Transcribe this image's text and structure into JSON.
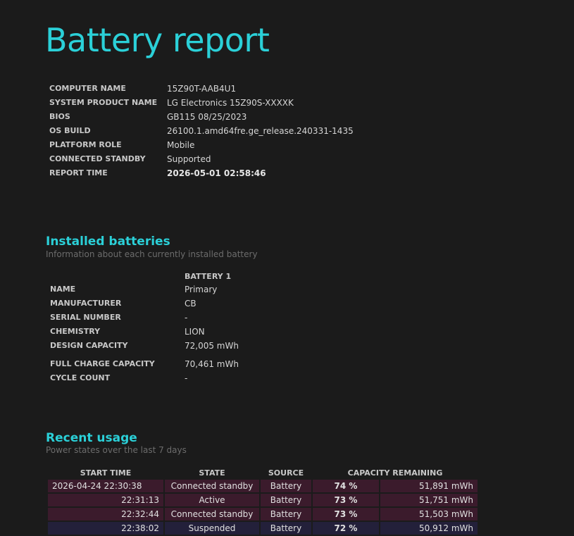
{
  "title": "Battery report",
  "system": [
    {
      "label": "COMPUTER NAME",
      "value": "15Z90T-AAB4U1"
    },
    {
      "label": "SYSTEM PRODUCT NAME",
      "value": "LG Electronics 15Z90S-XXXXK"
    },
    {
      "label": "BIOS",
      "value": "GB115 08/25/2023"
    },
    {
      "label": "OS BUILD",
      "value": "26100.1.amd64fre.ge_release.240331-1435"
    },
    {
      "label": "PLATFORM ROLE",
      "value": "Mobile"
    },
    {
      "label": "CONNECTED STANDBY",
      "value": "Supported"
    },
    {
      "label": "REPORT TIME",
      "value": "2026-05-01  02:58:46"
    }
  ],
  "installed": {
    "title": "Installed batteries",
    "subtitle": "Information about each currently installed battery",
    "battery_header": "BATTERY 1",
    "rows": [
      {
        "label": "NAME",
        "value": "Primary"
      },
      {
        "label": "MANUFACTURER",
        "value": "CB"
      },
      {
        "label": "SERIAL NUMBER",
        "value": "-"
      },
      {
        "label": "CHEMISTRY",
        "value": "LION"
      },
      {
        "label": "DESIGN CAPACITY",
        "value": "72,005 mWh"
      },
      {
        "label": "FULL CHARGE CAPACITY",
        "value": "70,461 mWh"
      },
      {
        "label": "CYCLE COUNT",
        "value": "-"
      }
    ]
  },
  "recent": {
    "title": "Recent usage",
    "subtitle": "Power states over the last 7 days",
    "columns": [
      "START TIME",
      "STATE",
      "SOURCE",
      "CAPACITY REMAINING"
    ],
    "rows": [
      {
        "time": "2026-04-24  22:30:38",
        "state": "Connected standby",
        "source": "Battery",
        "pct": "74 %",
        "mwh": "51,891 mWh"
      },
      {
        "time": "22:31:13",
        "state": "Active",
        "source": "Battery",
        "pct": "73 %",
        "mwh": "51,751 mWh"
      },
      {
        "time": "22:32:44",
        "state": "Connected standby",
        "source": "Battery",
        "pct": "73 %",
        "mwh": "51,503 mWh"
      },
      {
        "time": "22:38:02",
        "state": "Suspended",
        "source": "Battery",
        "pct": "72 %",
        "mwh": "50,912 mWh"
      }
    ]
  }
}
